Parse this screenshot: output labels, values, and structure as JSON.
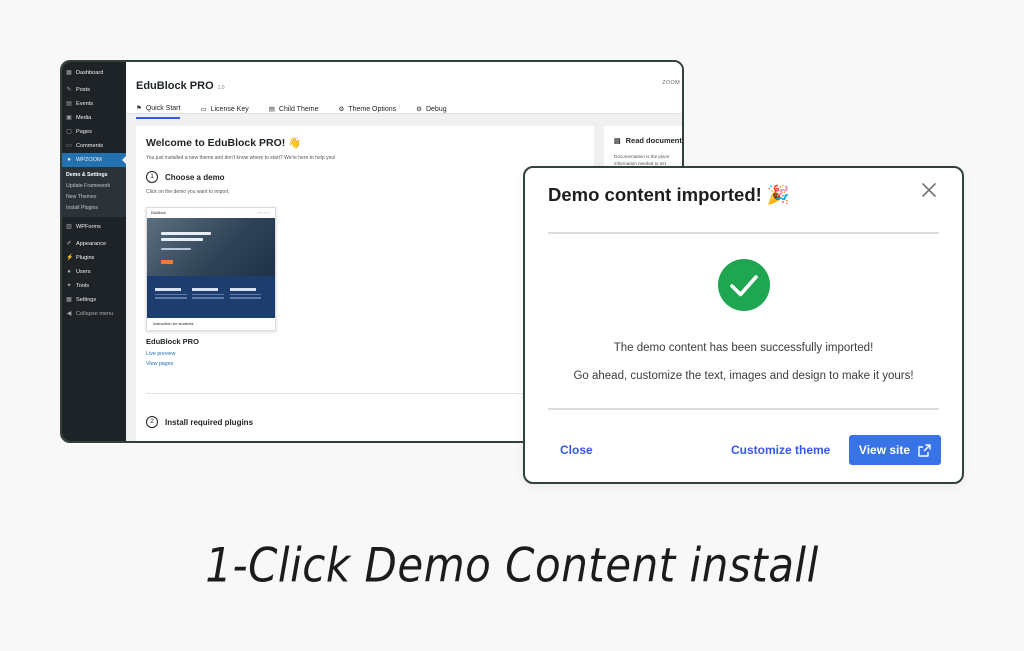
{
  "sidebar": {
    "items": [
      {
        "label": "Dashboard",
        "icon": "dashboard-icon"
      },
      {
        "label": "Posts",
        "icon": "pin-icon"
      },
      {
        "label": "Events",
        "icon": "calendar-icon"
      },
      {
        "label": "Media",
        "icon": "media-icon"
      },
      {
        "label": "Pages",
        "icon": "page-icon"
      },
      {
        "label": "Comments",
        "icon": "comment-icon"
      },
      {
        "label": "WPZOOM",
        "icon": "wpzoom-icon"
      }
    ],
    "submenu": [
      "Demo & Settings",
      "Update Framework",
      "New Themes",
      "Install Plugins"
    ],
    "items_after": [
      {
        "label": "WPForms",
        "icon": "form-icon"
      },
      {
        "label": "Appearance",
        "icon": "brush-icon"
      },
      {
        "label": "Plugins",
        "icon": "plug-icon"
      },
      {
        "label": "Users",
        "icon": "user-icon"
      },
      {
        "label": "Tools",
        "icon": "wrench-icon"
      },
      {
        "label": "Settings",
        "icon": "settings-icon"
      },
      {
        "label": "Collapse menu",
        "icon": "collapse-icon"
      }
    ]
  },
  "header": {
    "title": "EduBlock PRO",
    "version": "1.0",
    "brand": "ZOOM",
    "tabs": [
      "Quick Start",
      "License Key",
      "Child Theme",
      "Theme Options",
      "Debug"
    ]
  },
  "welcome": {
    "title": "Welcome to EduBlock PRO! 👋",
    "subtitle": "You just installed a new theme and don't know where to start? We're here to help you!",
    "step1_num": "1",
    "step1_label": "Choose a demo",
    "step1_hint": "Click on the demo you want to import.",
    "thumb_brand": "EduBlock",
    "thumb_footer": "Instruction for students",
    "demo_name": "EduBlock PRO",
    "live_preview": "Live preview",
    "view_pages": "View pages",
    "step2_num": "2",
    "step2_label": "Install required plugins"
  },
  "docs": {
    "title": "Read documentation",
    "text_line1": "Documentation is the place",
    "text_line2": "information needed to set"
  },
  "modal": {
    "title": "Demo content imported! 🎉",
    "message1": "The demo content has been successfully imported!",
    "message2": "Go ahead, customize the text, images and design to make it yours!",
    "close_label": "Close",
    "customize_label": "Customize theme",
    "view_label": "View site",
    "colors": {
      "success": "#1ea651",
      "primary": "#3873e8",
      "link": "#3858e9"
    }
  },
  "caption": "1-Click Demo Content install"
}
